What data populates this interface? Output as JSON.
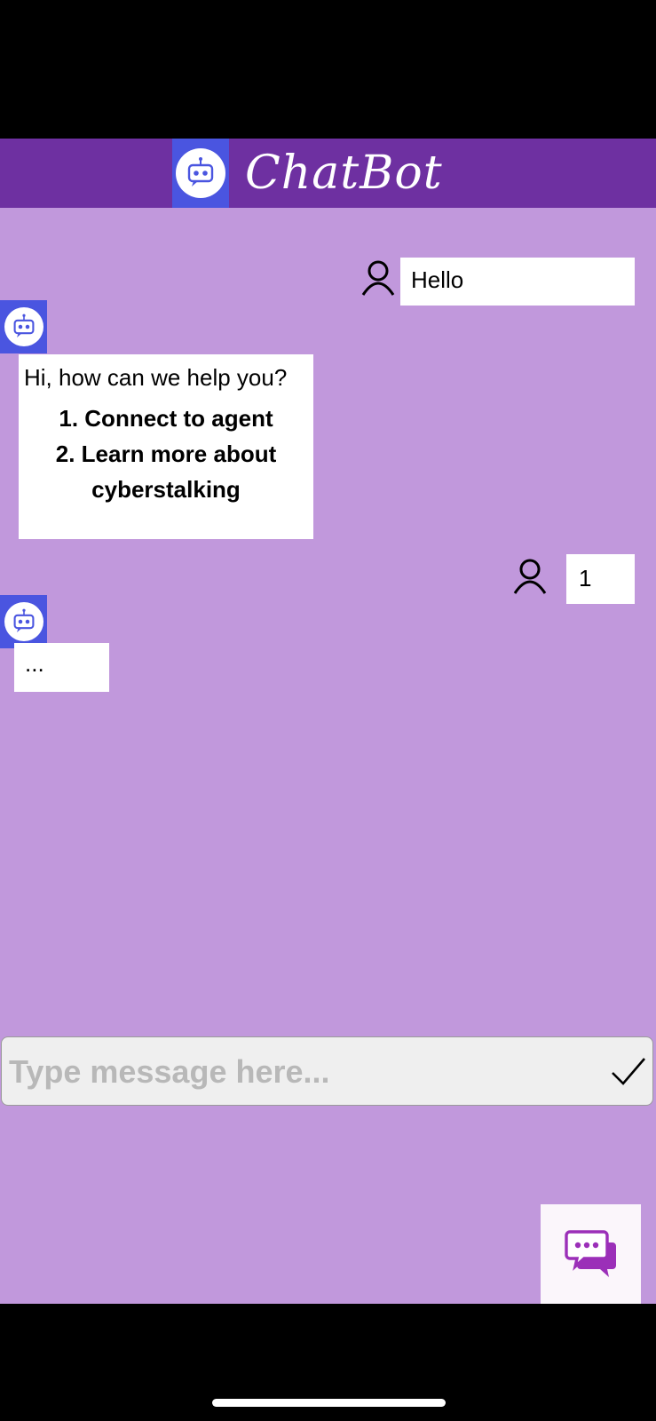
{
  "header": {
    "title": "ChatBot",
    "logo_icon": "robot-icon"
  },
  "colors": {
    "header_bg": "#6e30a1",
    "logo_bg": "#4a55e0",
    "chat_bg": "#c198dc",
    "bubble_bg": "#ffffff",
    "fab_icon": "#9b2fb8"
  },
  "messages": [
    {
      "sender": "user",
      "text": "Hello"
    },
    {
      "sender": "bot",
      "text": "Hi, how can we help you?",
      "options": [
        "1. Connect to agent",
        "2. Learn more about cyberstalking"
      ]
    },
    {
      "sender": "user",
      "text": "1"
    },
    {
      "sender": "bot",
      "text": "..."
    }
  ],
  "composer": {
    "placeholder": "Type message here...",
    "send_icon": "checkmark-icon"
  },
  "fab": {
    "icon": "chat-bubbles-icon"
  }
}
